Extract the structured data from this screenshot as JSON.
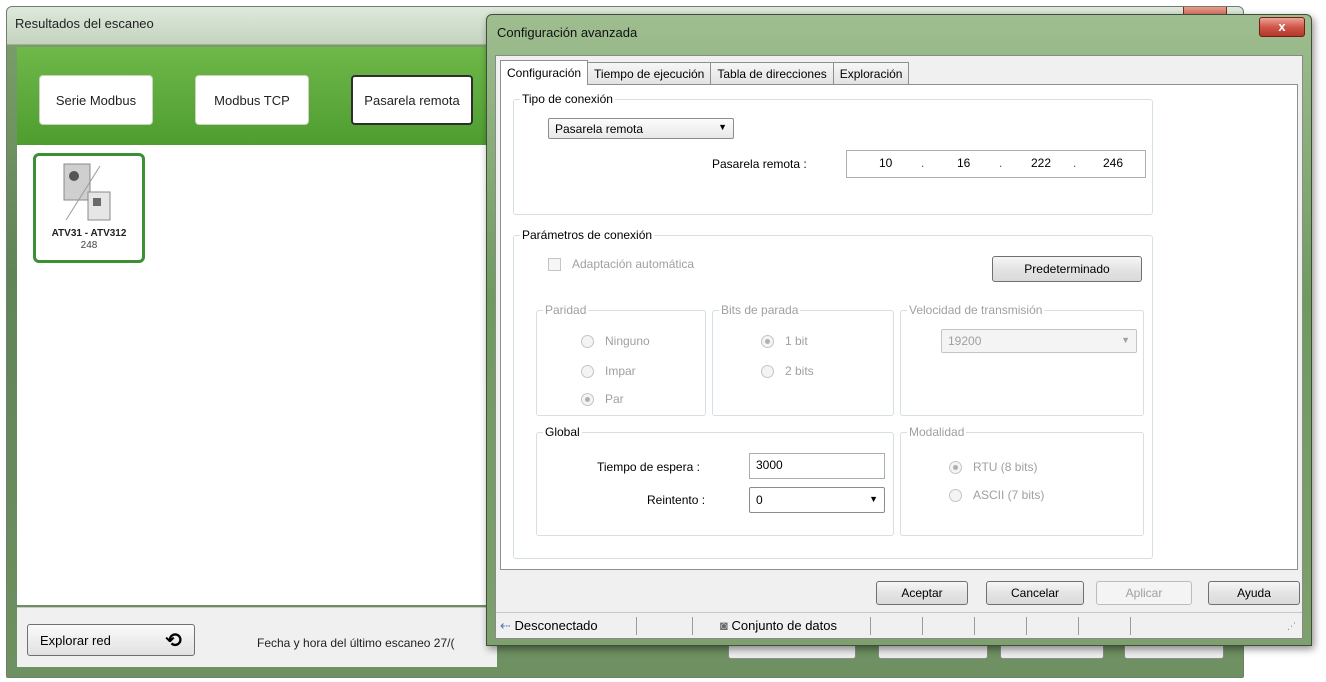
{
  "background_window": {
    "title": "Resultados del escaneo",
    "modes": [
      "Serie Modbus",
      "Modbus TCP",
      "Pasarela remota"
    ],
    "active_mode": "Pasarela remota",
    "device": {
      "name": "ATV31 - ATV312",
      "address": "248"
    },
    "explore_label": "Explorar red",
    "last_scan_text": "Fecha y hora del último escaneo 27/("
  },
  "dialog": {
    "title": "Configuración avanzada",
    "close_label": "x",
    "tabs": [
      "Configuración",
      "Tiempo de ejecución",
      "Tabla de direcciones",
      "Exploración"
    ],
    "connection_type": {
      "legend": "Tipo de conexión",
      "selected": "Pasarela remota",
      "gateway_label": "Pasarela remota :",
      "ip": [
        "10",
        "16",
        "222",
        "246"
      ]
    },
    "connection_params": {
      "legend": "Parámetros de conexión",
      "auto_adapt_label": "Adaptación automática",
      "default_button": "Predeterminado",
      "parity": {
        "legend": "Paridad",
        "options": [
          "Ninguno",
          "Impar",
          "Par"
        ],
        "selected": "Par"
      },
      "stop_bits": {
        "legend": "Bits de parada",
        "options": [
          "1 bit",
          "2 bits"
        ],
        "selected": "1 bit"
      },
      "baud": {
        "legend": "Velocidad de transmisión",
        "value": "19200"
      },
      "global": {
        "legend": "Global",
        "timeout_label": "Tiempo de espera :",
        "timeout_value": "3000",
        "retry_label": "Reintento :",
        "retry_value": "0"
      },
      "mode": {
        "legend": "Modalidad",
        "options": [
          "RTU (8 bits)",
          "ASCII (7 bits)"
        ],
        "selected": "RTU (8 bits)"
      }
    },
    "buttons": {
      "accept": "Aceptar",
      "cancel": "Cancelar",
      "apply": "Aplicar",
      "help": "Ayuda"
    },
    "status": {
      "connection": "Desconectado",
      "dataset": "Conjunto de datos"
    }
  }
}
